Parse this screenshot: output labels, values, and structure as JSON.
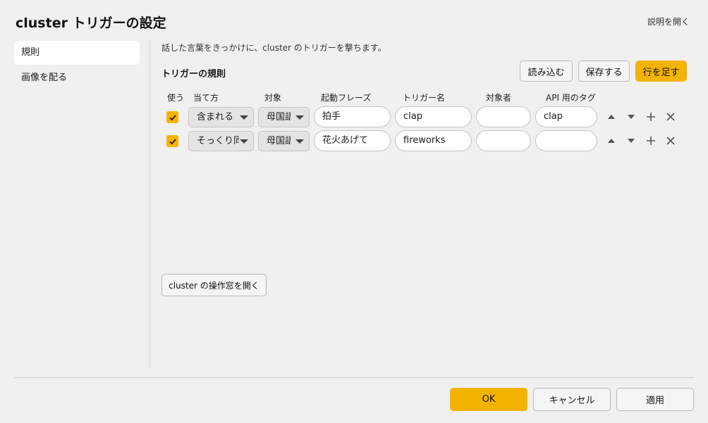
{
  "window": {
    "title": "cluster トリガーの設定",
    "help_link": "説明を開く"
  },
  "sidebar": {
    "items": [
      {
        "label": "規則",
        "active": true
      },
      {
        "label": "画像を配る",
        "active": false
      }
    ]
  },
  "main": {
    "description": "話した言葉をきっかけに、cluster のトリガーを撃ちます。",
    "rules_title": "トリガーの規則",
    "buttons": {
      "load": "読み込む",
      "save": "保存する",
      "add_row": "行を足す"
    },
    "columns": [
      "使う",
      "当て方",
      "対象",
      "起動フレーズ",
      "トリガー名",
      "対象者",
      "API 用のタグ"
    ],
    "rows": [
      {
        "enabled": true,
        "match_mode": "含まれる",
        "target": "母国語",
        "phrase": "拍手",
        "trigger": "clap",
        "target_user": "",
        "api_tag": "clap"
      },
      {
        "enabled": true,
        "match_mode": "そっくり同じ",
        "target": "母国語",
        "phrase": "花火あげて",
        "trigger": "fireworks",
        "target_user": "",
        "api_tag": ""
      }
    ],
    "row_icons": [
      "triangle-up-icon",
      "triangle-down-icon",
      "plus-icon",
      "close-icon"
    ],
    "open_panel_button": "cluster の操作窓を開く"
  },
  "footer": {
    "ok": "OK",
    "cancel": "キャンセル",
    "apply": "適用"
  },
  "colors": {
    "accent": "#f3b300",
    "background": "#f0f0f0",
    "field": "#ffffff"
  }
}
